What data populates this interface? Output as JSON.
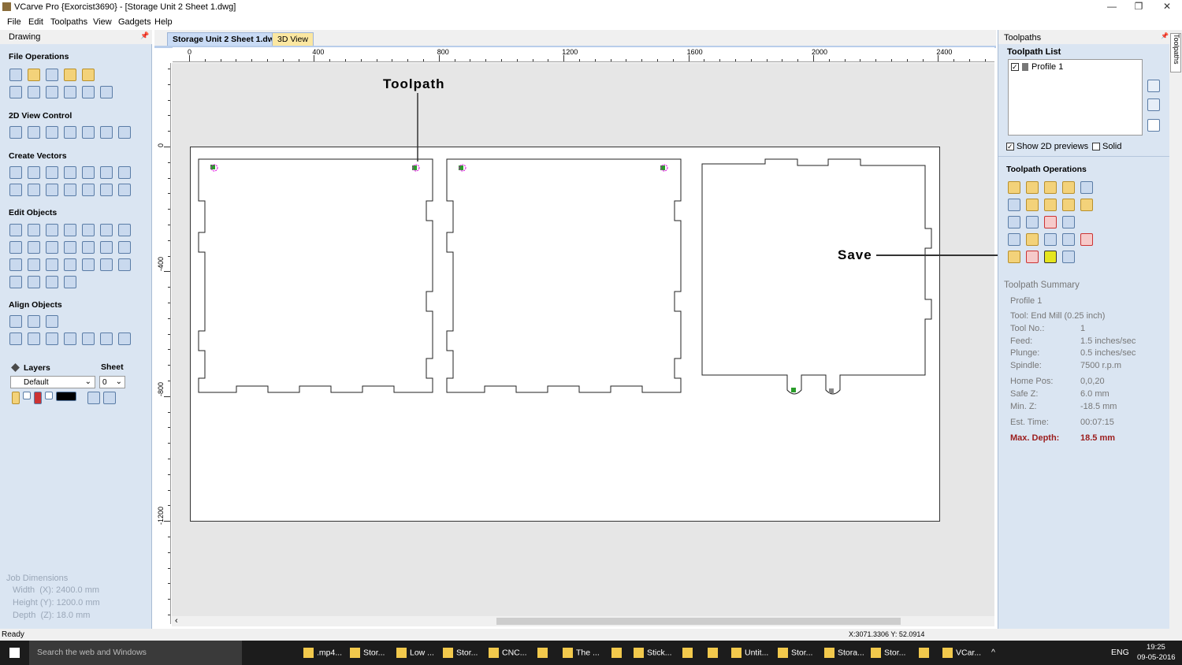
{
  "window": {
    "title": "VCarve Pro {Exorcist3690} - [Storage Unit 2 Sheet 1.dwg]",
    "controls": [
      "—",
      "❐",
      "✕"
    ]
  },
  "menu": [
    "File",
    "Edit",
    "Toolpaths",
    "View",
    "Gadgets",
    "Help"
  ],
  "left_panel": {
    "title": "Drawing",
    "sections": {
      "file_ops": "File Operations",
      "view_control": "2D View Control",
      "create_vectors": "Create Vectors",
      "edit_objects": "Edit Objects",
      "align_objects": "Align Objects"
    },
    "layers": {
      "label": "Layers",
      "sheet_label": "Sheet",
      "layer_value": "Default",
      "sheet_value": "0"
    },
    "job_dimensions": {
      "title": "Job Dimensions",
      "width": "Width  (X): 2400.0 mm",
      "height": "Height (Y): 1200.0 mm",
      "depth": "Depth  (Z): 18.0 mm"
    }
  },
  "tabs": [
    {
      "label": "Storage Unit 2 Sheet 1.dwg",
      "active": true
    },
    {
      "label": "3D View",
      "active": false
    }
  ],
  "rulers": {
    "h_ticks": [
      "0",
      "400",
      "800",
      "1200",
      "1600",
      "2000",
      "2400"
    ],
    "v_ticks": [
      "0",
      "-400",
      "-800",
      "-1200"
    ]
  },
  "annotations": {
    "toolpath": "Toolpath",
    "save": "Save"
  },
  "right_panel": {
    "title": "Toolpaths",
    "list_title": "Toolpath List",
    "items": [
      {
        "label": "Profile 1",
        "checked": true
      }
    ],
    "show_2d_previews": {
      "label": "Show 2D previews",
      "checked": true
    },
    "solid": {
      "label": "Solid",
      "checked": false
    },
    "operations_title": "Toolpath Operations",
    "side_tab": "Toolpaths",
    "summary": {
      "title": "Toolpath Summary",
      "name": "Profile 1",
      "tool": "Tool: End Mill (0.25 inch)",
      "rows": [
        [
          "Tool No.:",
          "1"
        ],
        [
          "Feed:",
          "1.5 inches/sec"
        ],
        [
          "Plunge:",
          "0.5 inches/sec"
        ],
        [
          "Spindle:",
          "7500 r.p.m"
        ],
        [
          "Home Pos:",
          "0,0,20"
        ],
        [
          "Safe Z:",
          "6.0 mm"
        ],
        [
          "Min. Z:",
          "-18.5 mm"
        ],
        [
          "Est. Time:",
          "00:07:15"
        ]
      ],
      "max_depth": [
        "Max. Depth:",
        "18.5 mm"
      ],
      "max_depth_color": "#9b1c1c"
    }
  },
  "status": {
    "text": "Ready",
    "coords": "X:3071.3306 Y: 52.0914"
  },
  "taskbar": {
    "search": "Search the web and Windows",
    "apps": [
      ".mp4...",
      "Stor...",
      "Low ...",
      "Stor...",
      "CNC...",
      "",
      "The ...",
      "",
      "Stick...",
      "",
      "",
      "Untit...",
      "Stor...",
      "Stora...",
      "Stor...",
      "",
      "VCar..."
    ],
    "lang": "ENG",
    "time": "19:25",
    "date": "09-05-2016"
  }
}
